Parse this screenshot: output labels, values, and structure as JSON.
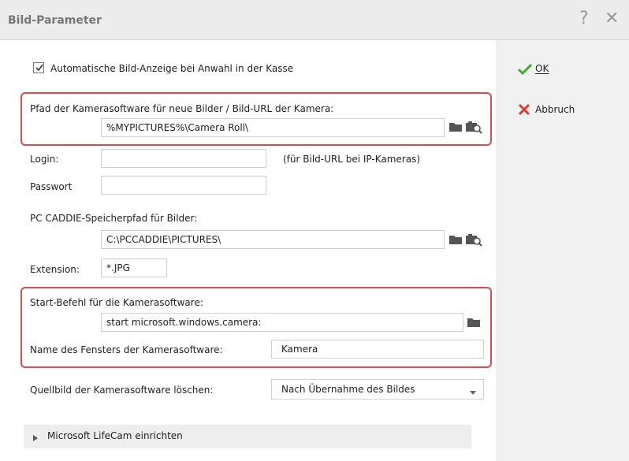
{
  "window": {
    "title": "Bild-Parameter",
    "help_label": "?",
    "close_label": "✕"
  },
  "auto_display": {
    "label": "Automatische Bild-Anzeige bei Anwahl in der Kasse",
    "checked": true
  },
  "camera_path": {
    "label": "Pfad der Kamerasoftware für neue Bilder / Bild-URL der Kamera:",
    "value": "%MYPICTURES%\\Camera Roll\\"
  },
  "login": {
    "label": "Login:",
    "value": "",
    "hint": "(für Bild-URL bei IP-Kameras)"
  },
  "password": {
    "label": "Passwort",
    "value": ""
  },
  "save_path": {
    "label": "PC CADDIE-Speicherpfad für Bilder:",
    "value": "C:\\PCCADDIE\\PICTURES\\"
  },
  "extension": {
    "label": "Extension:",
    "value": "*.JPG"
  },
  "start_command": {
    "label": "Start-Befehl für die Kamerasoftware:",
    "value": "start microsoft.windows.camera:"
  },
  "window_name": {
    "label": "Name des Fensters der Kamerasoftware:",
    "value": "Kamera"
  },
  "delete_source": {
    "label": "Quellbild der Kamerasoftware löschen:",
    "selected": "Nach Übernahme des Bildes"
  },
  "lifecam": {
    "label": "Microsoft LifeCam einrichten"
  },
  "buttons": {
    "ok": "OK",
    "cancel": "Abbruch"
  },
  "colors": {
    "highlight": "#e14b4b",
    "ok_check": "#3fae2a",
    "cancel_x": "#e03a2f",
    "folder_icon": "#555555"
  }
}
